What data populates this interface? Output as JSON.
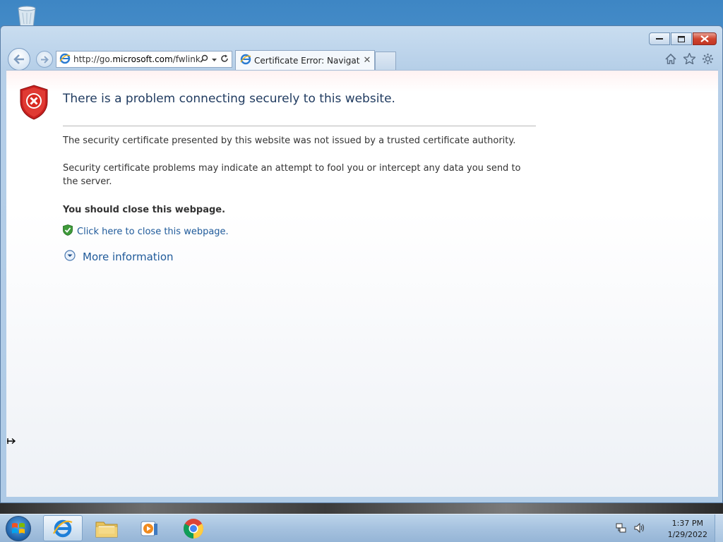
{
  "browser": {
    "address_url_prefix": "http://go.",
    "address_url_domain": "microsoft.com",
    "address_url_rest": "/fwlink/",
    "tab_title": "Certificate Error: Navigatio...",
    "tab_close": "✕"
  },
  "error_page": {
    "title": "There is a problem connecting securely to this website.",
    "paragraph1": "The security certificate presented by this website was not issued by a trusted certificate authority.",
    "paragraph2": "Security certificate problems may indicate an attempt to fool you or intercept any data you send to the server.",
    "paragraph3": "You should close this webpage.",
    "close_link": "Click here to close this webpage.",
    "more_info": "More information"
  },
  "taskbar": {
    "time": "1:37 PM",
    "date": "1/29/2022"
  },
  "colors": {
    "link": "#1f5a9a",
    "title": "#1f3a5f",
    "shield_red": "#c8201f",
    "shield_green": "#3f9a3a"
  }
}
